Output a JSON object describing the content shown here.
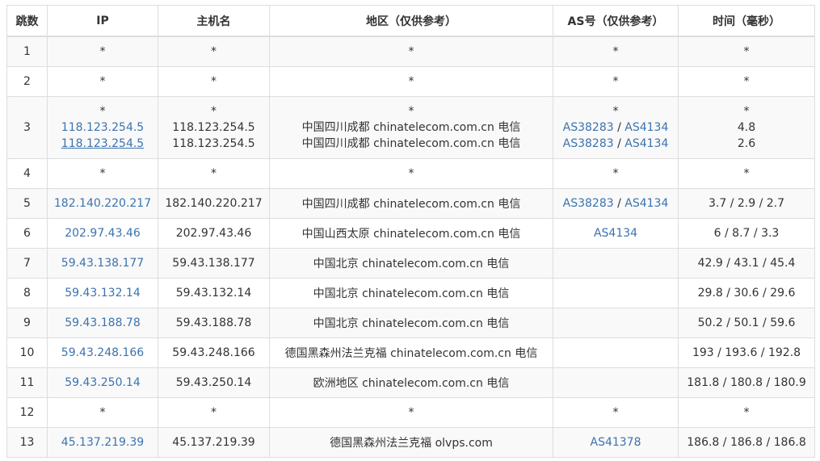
{
  "table": {
    "headers": [
      "跳数",
      "IP",
      "主机名",
      "地区（仅供参考）",
      "AS号（仅供参考）",
      "时间（毫秒）"
    ],
    "rows": [
      {
        "hop": "1",
        "ip": "*",
        "host": "*",
        "region": "*",
        "as": "*",
        "time": "*"
      },
      {
        "hop": "2",
        "ip": "*",
        "host": "*",
        "region": "*",
        "as": "*",
        "time": "*"
      },
      {
        "hop": "3",
        "multi": [
          {
            "ip": "*",
            "host": "*",
            "region": "*",
            "as1": "*",
            "as2": "",
            "time": "*"
          },
          {
            "ip": "118.123.254.5",
            "host": "118.123.254.5",
            "region": "中国四川成都 chinatelecom.com.cn 电信",
            "as1": "AS38283",
            "as2": "AS4134",
            "time": "4.8"
          },
          {
            "ip": "118.123.254.5",
            "host": "118.123.254.5",
            "region": "中国四川成都 chinatelecom.com.cn 电信",
            "as1": "AS38283",
            "as2": "AS4134",
            "time": "2.6"
          }
        ]
      },
      {
        "hop": "4",
        "ip": "*",
        "host": "*",
        "region": "*",
        "as": "*",
        "time": "*"
      },
      {
        "hop": "5",
        "ip": "182.140.220.217",
        "host": "182.140.220.217",
        "region": "中国四川成都 chinatelecom.com.cn 电信",
        "as1": "AS38283",
        "as2": "AS4134",
        "time": "3.7 / 2.9 / 2.7"
      },
      {
        "hop": "6",
        "ip": "202.97.43.46",
        "host": "202.97.43.46",
        "region": "中国山西太原 chinatelecom.com.cn 电信",
        "as1": "AS4134",
        "time": "6 / 8.7 / 3.3"
      },
      {
        "hop": "7",
        "ip": "59.43.138.177",
        "host": "59.43.138.177",
        "region": "中国北京 chinatelecom.com.cn 电信",
        "time": "42.9 / 43.1 / 45.4"
      },
      {
        "hop": "8",
        "ip": "59.43.132.14",
        "host": "59.43.132.14",
        "region": "中国北京 chinatelecom.com.cn 电信",
        "time": "29.8 / 30.6 / 29.6"
      },
      {
        "hop": "9",
        "ip": "59.43.188.78",
        "host": "59.43.188.78",
        "region": "中国北京 chinatelecom.com.cn 电信",
        "time": "50.2 / 50.1 / 59.6"
      },
      {
        "hop": "10",
        "ip": "59.43.248.166",
        "host": "59.43.248.166",
        "region": "德国黑森州法兰克福 chinatelecom.com.cn 电信",
        "time": "193 / 193.6 / 192.8"
      },
      {
        "hop": "11",
        "ip": "59.43.250.14",
        "host": "59.43.250.14",
        "region": "欧洲地区 chinatelecom.com.cn 电信",
        "time": "181.8 / 180.8 / 180.9"
      },
      {
        "hop": "12",
        "ip": "*",
        "host": "*",
        "region": "*",
        "as": "*",
        "time": "*"
      },
      {
        "hop": "13",
        "ip": "45.137.219.39",
        "host": "45.137.219.39",
        "region": "德国黑森州法兰克福 olvps.com",
        "as1": "AS41378",
        "time": "186.8 / 186.8 / 186.8"
      }
    ]
  },
  "as_separator": " / ",
  "colors": {
    "link": "#3b73af",
    "text": "#333333",
    "border": "#dddddd",
    "stripe": "#f9f9f9"
  }
}
